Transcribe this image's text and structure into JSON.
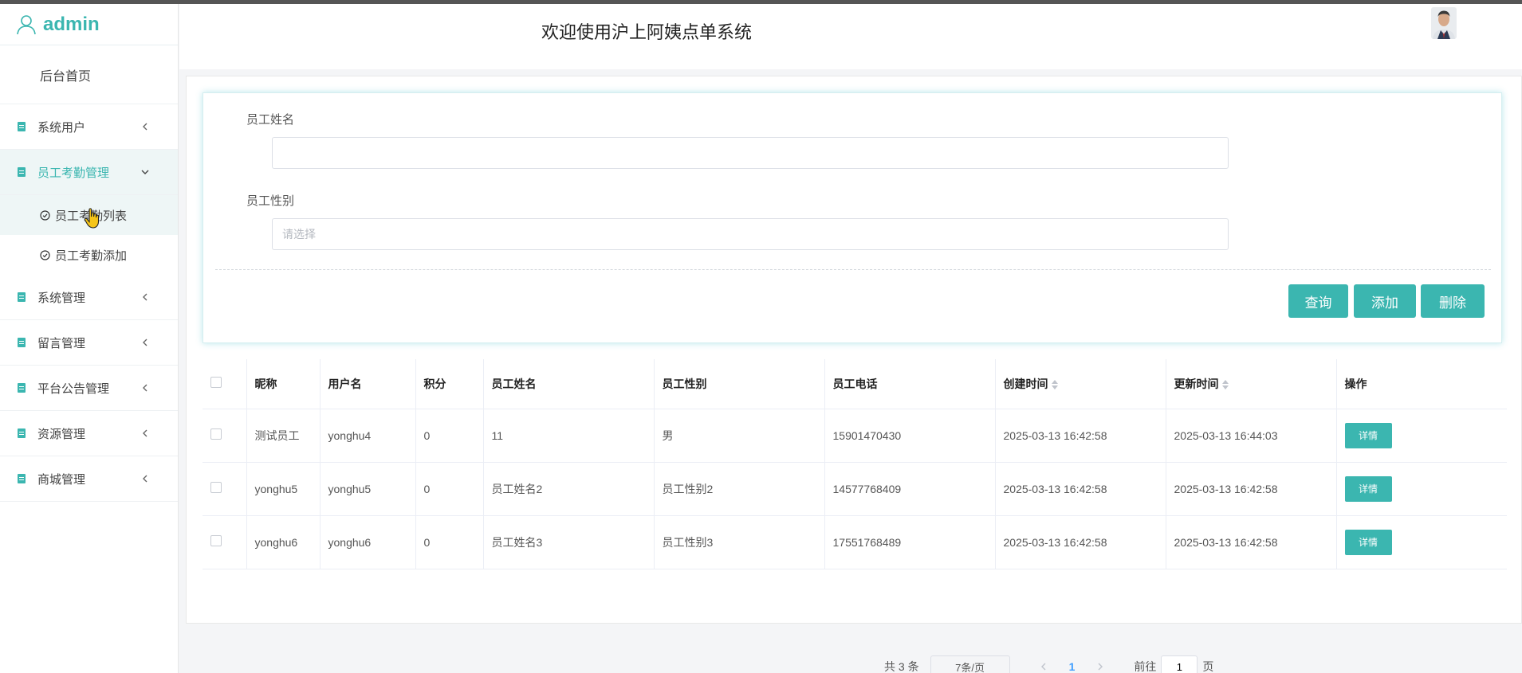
{
  "brand": {
    "name": "admin"
  },
  "header": {
    "title": "欢迎使用沪上阿姨点单系统"
  },
  "sidebar": {
    "home": "后台首页",
    "items": [
      {
        "label": "系统用户"
      },
      {
        "label": "员工考勤管理",
        "children": [
          "员工考勤列表",
          "员工考勤添加"
        ]
      },
      {
        "label": "系统管理"
      },
      {
        "label": "留言管理"
      },
      {
        "label": "平台公告管理"
      },
      {
        "label": "资源管理"
      },
      {
        "label": "商城管理"
      }
    ]
  },
  "search": {
    "name_label": "员工姓名",
    "name_value": "",
    "gender_label": "员工性别",
    "gender_placeholder": "请选择",
    "query_btn": "查询",
    "add_btn": "添加",
    "delete_btn": "删除"
  },
  "table": {
    "columns": [
      "昵称",
      "用户名",
      "积分",
      "员工姓名",
      "员工性别",
      "员工电话",
      "创建时间",
      "更新时间",
      "操作"
    ],
    "detail_label": "详情",
    "rows": [
      [
        "测试员工",
        "yonghu4",
        "0",
        "11",
        "男",
        "15901470430",
        "2025-03-13 16:42:58",
        "2025-03-13 16:44:03"
      ],
      [
        "yonghu5",
        "yonghu5",
        "0",
        "员工姓名2",
        "员工性别2",
        "14577768409",
        "2025-03-13 16:42:58",
        "2025-03-13 16:42:58"
      ],
      [
        "yonghu6",
        "yonghu6",
        "0",
        "员工姓名3",
        "员工性别3",
        "17551768489",
        "2025-03-13 16:42:58",
        "2025-03-13 16:42:58"
      ]
    ]
  },
  "pagination": {
    "total": "共 3 条",
    "page_size": "7条/页",
    "current_page": "1",
    "goto_prefix": "前往",
    "goto_value": "1",
    "goto_suffix": "页"
  },
  "colors": {
    "accent": "#3bb6b0",
    "page_link": "#409eff"
  }
}
